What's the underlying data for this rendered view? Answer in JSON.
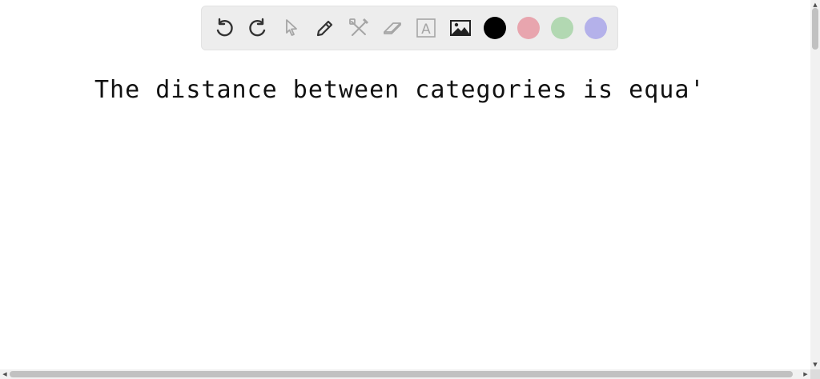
{
  "canvas": {
    "text": "The distance between categories is equa'"
  },
  "toolbar": {
    "tools": [
      {
        "name": "undo-icon"
      },
      {
        "name": "redo-icon"
      },
      {
        "name": "pointer-icon"
      },
      {
        "name": "pen-icon"
      },
      {
        "name": "tools-icon"
      },
      {
        "name": "eraser-icon"
      },
      {
        "name": "text-icon",
        "glyph": "A"
      },
      {
        "name": "image-icon"
      }
    ],
    "colors": [
      "#000000",
      "#e8a5ae",
      "#b2d8b2",
      "#b4b1ea"
    ]
  },
  "scrollbars": {
    "up_arrow": "▲",
    "down_arrow": "▼",
    "left_arrow": "◀",
    "right_arrow": "▶"
  }
}
